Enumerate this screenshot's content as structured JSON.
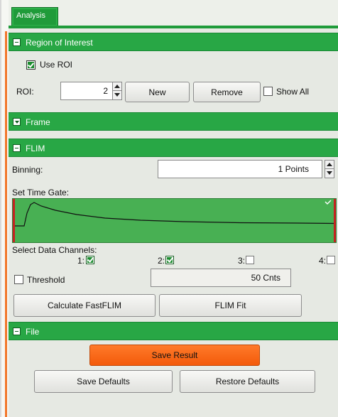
{
  "tabs": {
    "active": "Analysis"
  },
  "sections": {
    "roi": "Region of Interest",
    "frame": "Frame",
    "flim": "FLIM",
    "file": "File"
  },
  "roi": {
    "use_roi_label": "Use ROI",
    "use_roi_checked": true,
    "roi_label": "ROI:",
    "roi_value": "2",
    "new_button": "New",
    "remove_button": "Remove",
    "show_all_label": "Show All",
    "show_all_checked": false
  },
  "flim": {
    "binning_label": "Binning:",
    "binning_value": "1 Points",
    "time_gate_label": "Set Time Gate:",
    "select_channels_label": "Select Data Channels:",
    "channels": [
      {
        "label": "1:",
        "checked": true
      },
      {
        "label": "2:",
        "checked": true
      },
      {
        "label": "3:",
        "checked": false
      },
      {
        "label": "4:",
        "checked": false
      }
    ],
    "threshold_label": "Threshold",
    "threshold_checked": false,
    "threshold_value": "50 Cnts",
    "calculate_button": "Calculate FastFLIM",
    "fit_button": "FLIM Fit"
  },
  "file": {
    "save_result_button": "Save Result",
    "save_defaults_button": "Save Defaults",
    "restore_defaults_button": "Restore Defaults"
  },
  "colors": {
    "header_green": "#28a745",
    "accent_orange": "#f35a0a",
    "gate_marker_red": "#c62121"
  }
}
